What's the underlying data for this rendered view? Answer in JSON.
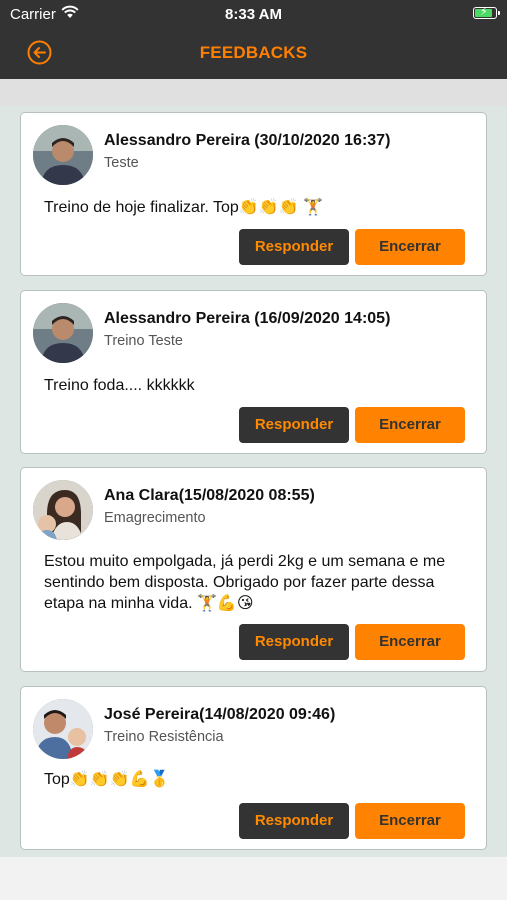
{
  "status_bar": {
    "carrier": "Carrier",
    "time": "8:33 AM"
  },
  "header": {
    "title": "FEEDBACKS"
  },
  "feedbacks": [
    {
      "name": "Alessandro Pereira (30/10/2020 16:37)",
      "subtitle": "Teste",
      "message": "Treino de hoje finalizar. Top👏👏👏 🏋️",
      "reply_label": "Responder",
      "close_label": "Encerrar"
    },
    {
      "name": "Alessandro Pereira (16/09/2020 14:05)",
      "subtitle": "Treino Teste",
      "message": "Treino foda.... kkkkkk",
      "reply_label": "Responder",
      "close_label": "Encerrar"
    },
    {
      "name": "Ana Clara(15/08/2020 08:55)",
      "subtitle": "Emagrecimento",
      "message": "Estou muito empolgada, já perdi 2kg e um semana e me sentindo bem disposta. Obrigado por fazer parte dessa etapa na minha vida. 🏋️💪😘",
      "reply_label": "Responder",
      "close_label": "Encerrar"
    },
    {
      "name": "José Pereira(14/08/2020 09:46)",
      "subtitle": "Treino Resistência",
      "message": "Top👏👏👏💪🥇",
      "reply_label": "Responder",
      "close_label": "Encerrar"
    }
  ],
  "colors": {
    "accent": "#ff8200",
    "dark": "#333333",
    "list_background": "#dde6e2"
  }
}
